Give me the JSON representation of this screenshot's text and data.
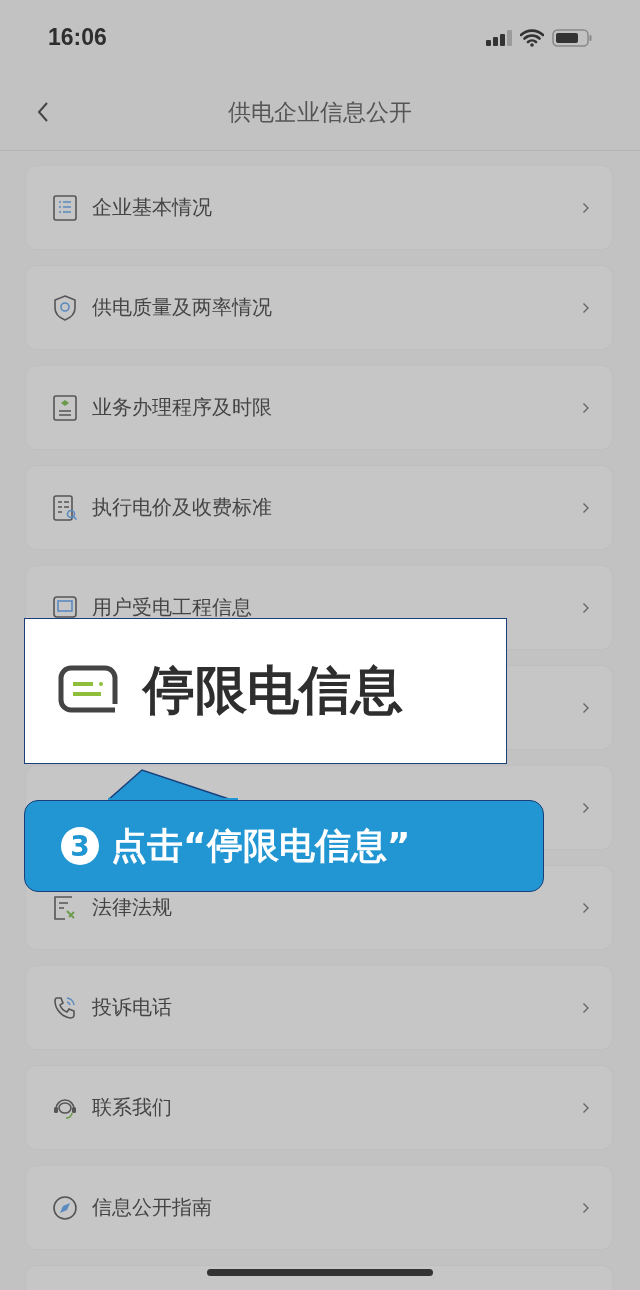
{
  "status_bar": {
    "time": "16:06"
  },
  "nav": {
    "title": "供电企业信息公开"
  },
  "items": [
    {
      "label": "企业基本情况"
    },
    {
      "label": "供电质量及两率情况"
    },
    {
      "label": "业务办理程序及时限"
    },
    {
      "label": "执行电价及收费标准"
    },
    {
      "label": "用户受电工程信息"
    },
    {
      "label": "法律法规"
    },
    {
      "label": "投诉电话"
    },
    {
      "label": "联系我们"
    },
    {
      "label": "信息公开指南"
    }
  ],
  "popup": {
    "label": "停限电信息"
  },
  "callout": {
    "step": "3",
    "text": "点击“停限电信息”"
  }
}
